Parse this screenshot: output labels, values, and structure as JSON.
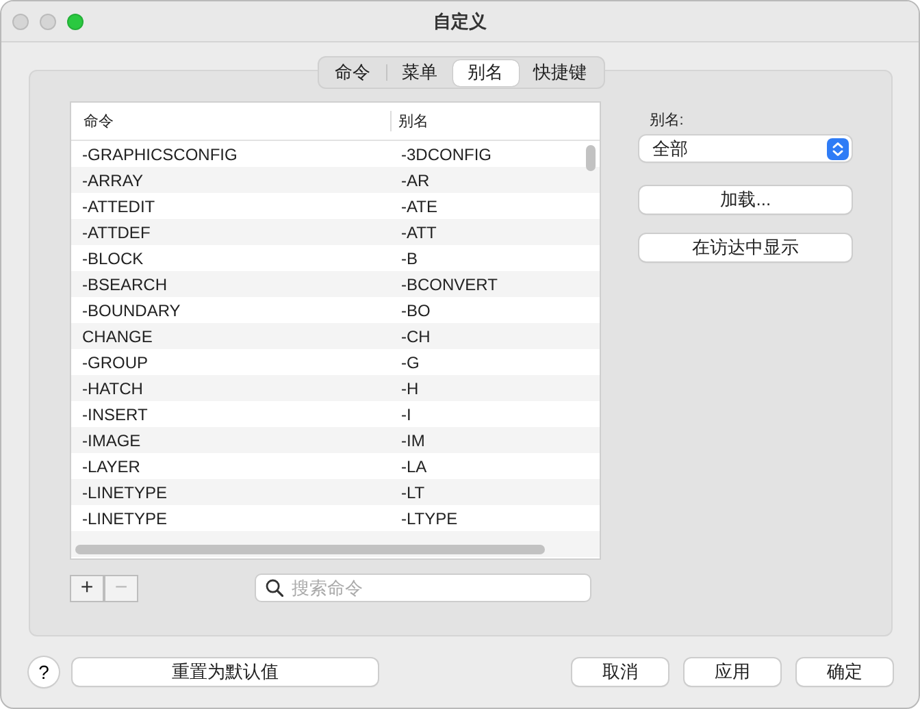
{
  "window": {
    "title": "自定义"
  },
  "tabs": [
    {
      "label": "命令",
      "selected": false
    },
    {
      "label": "菜单",
      "selected": false
    },
    {
      "label": "别名",
      "selected": true
    },
    {
      "label": "快捷键",
      "selected": false
    }
  ],
  "table": {
    "columns": [
      "命令",
      "别名"
    ],
    "rows": [
      [
        "-GRAPHICSCONFIG",
        "-3DCONFIG"
      ],
      [
        "-ARRAY",
        "-AR"
      ],
      [
        "-ATTEDIT",
        "-ATE"
      ],
      [
        "-ATTDEF",
        "-ATT"
      ],
      [
        "-BLOCK",
        "-B"
      ],
      [
        "-BSEARCH",
        "-BCONVERT"
      ],
      [
        "-BOUNDARY",
        "-BO"
      ],
      [
        "CHANGE",
        "-CH"
      ],
      [
        "-GROUP",
        "-G"
      ],
      [
        "-HATCH",
        "-H"
      ],
      [
        "-INSERT",
        "-I"
      ],
      [
        "-IMAGE",
        "-IM"
      ],
      [
        "-LAYER",
        "-LA"
      ],
      [
        "-LINETYPE",
        "-LT"
      ],
      [
        "-LINETYPE",
        "-LTYPE"
      ]
    ]
  },
  "list_buttons": [
    {
      "label": "+",
      "disabled": false
    },
    {
      "label": "−",
      "disabled": true
    }
  ],
  "search": {
    "placeholder": "搜索命令"
  },
  "alias_filter": {
    "label": "别名:",
    "value": "全部"
  },
  "side_buttons": [
    "加载...",
    "在访达中显示"
  ],
  "help_button": "?",
  "reset_button": "重置为默认值",
  "dialog_buttons": [
    "取消",
    "应用",
    "确定"
  ]
}
